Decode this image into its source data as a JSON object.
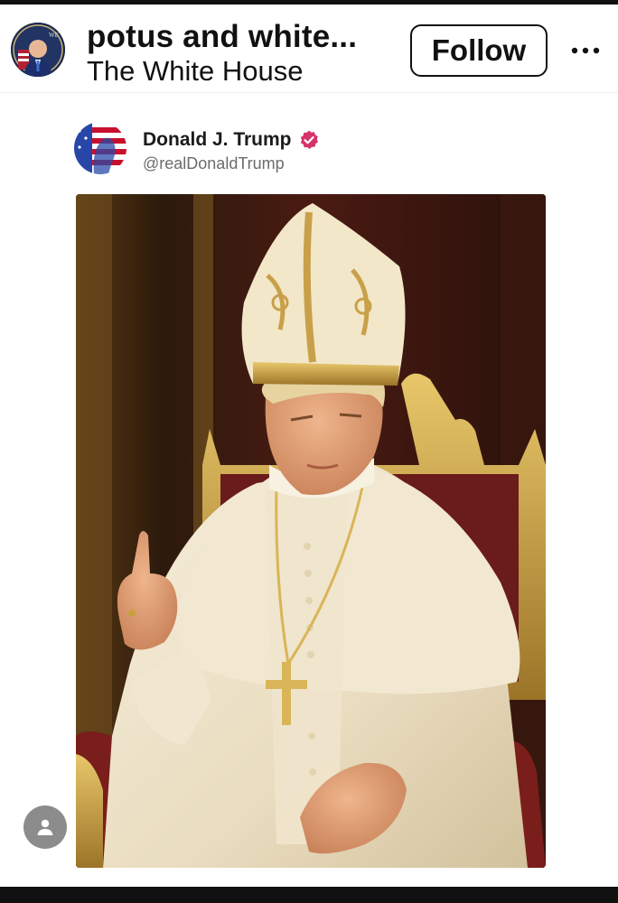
{
  "header": {
    "account_name": "potus and white...",
    "account_subtitle": "The White House",
    "follow_label": "Follow",
    "more_icon": "more-horizontal-icon"
  },
  "embedded_post": {
    "author_name": "Donald J. Trump",
    "author_handle": "@realDonaldTrump",
    "verified_icon": "verified-badge-icon",
    "verified_color": "#d6336c",
    "image_alt": "Portrait of a man dressed in papal white robes and a gold-embroidered mitre, seated on an ornate gilded throne, raising his index finger."
  },
  "floating": {
    "profile_icon": "person-icon"
  },
  "colors": {
    "text": "#111111",
    "handle": "#6b6b6b",
    "fab": "#8c8c8c"
  }
}
